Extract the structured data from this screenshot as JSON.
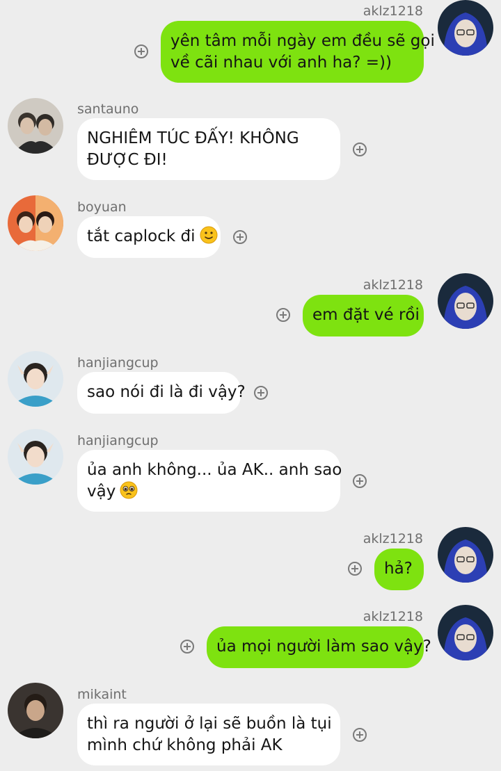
{
  "messages": [
    {
      "sender": "aklz1218",
      "lines": [
        "yên tâm mỗi ngày em đều sẽ gọi",
        "về cãi nhau với anh ha? =))"
      ]
    },
    {
      "sender": "santauno",
      "lines": [
        "NGHIÊM TÚC ĐẤY! KHÔNG",
        "ĐƯỢC ĐI!"
      ]
    },
    {
      "sender": "boyuan",
      "lines": [
        "tắt caplock đi"
      ],
      "emoji": "slightly-smiling-face-icon"
    },
    {
      "sender": "aklz1218",
      "lines": [
        "em đặt vé rồi"
      ]
    },
    {
      "sender": "hanjiangcup",
      "lines": [
        "sao nói đi là đi vậy?"
      ]
    },
    {
      "sender": "hanjiangcup",
      "lines": [
        "ủa anh không... ủa AK.. anh sao",
        "vậy"
      ],
      "emoji": "pleading-face-icon"
    },
    {
      "sender": "aklz1218",
      "lines": [
        "hả?"
      ]
    },
    {
      "sender": "aklz1218",
      "lines": [
        "ủa mọi người làm sao vậy?"
      ]
    },
    {
      "sender": "mikaint",
      "lines": [
        "thì ra người ở lại sẽ buồn là tụi",
        "mình chứ không phải AK"
      ]
    }
  ],
  "colors": {
    "background": "#ededed",
    "outgoing_bubble": "#7ee210",
    "incoming_bubble": "#ffffff"
  }
}
